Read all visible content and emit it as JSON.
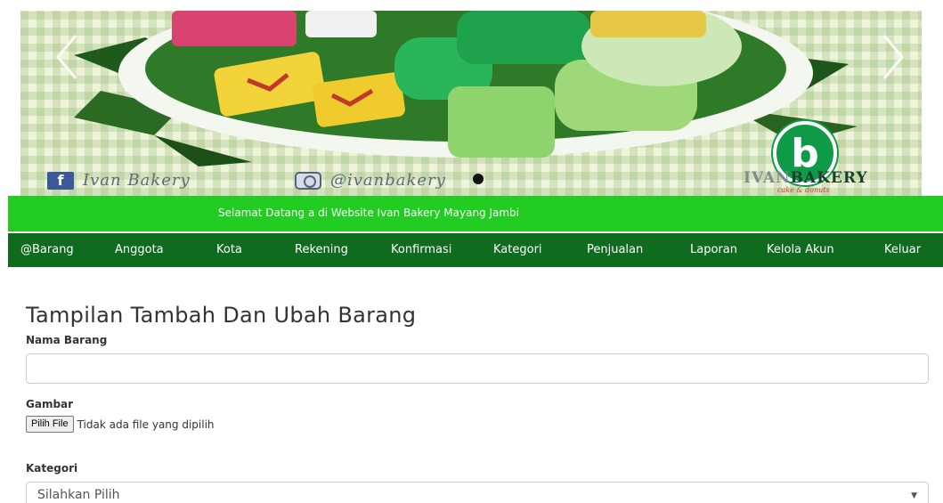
{
  "banner": {
    "facebook_icon": "f",
    "facebook_name": "Ivan Bakery",
    "instagram_handle": "@ivanbakery",
    "logo_mark": "b",
    "logo_brand_ivan": "IVAN",
    "logo_brand_bakery": "BAKERY",
    "logo_tagline": "cake & donuts",
    "prev_icon": "chevron-left-icon",
    "next_icon": "chevron-right-icon",
    "slide_count": 1,
    "active_slide": 1
  },
  "welcome": {
    "text": "Selamat Datang a di Website Ivan Bakery Mayang Jambi"
  },
  "nav": {
    "items": [
      {
        "label": "@Barang"
      },
      {
        "label": "Anggota"
      },
      {
        "label": "Kota"
      },
      {
        "label": "Rekening"
      },
      {
        "label": "Konfirmasi"
      },
      {
        "label": "Kategori"
      },
      {
        "label": "Penjualan"
      },
      {
        "label": "Laporan"
      },
      {
        "label": "Kelola Akun"
      },
      {
        "label": "Keluar"
      }
    ]
  },
  "form": {
    "title": "Tampilan Tambah Dan Ubah Barang",
    "nama_barang_label": "Nama Barang",
    "nama_barang_value": "",
    "gambar_label": "Gambar",
    "file_button": "Pilih File",
    "file_status": "Tidak ada file yang dipilih",
    "kategori_label": "Kategori",
    "kategori_selected": "Silahkan Pilih",
    "kategori_caret": "▼"
  },
  "colors": {
    "welcome_bar": "#22cc22",
    "navbar": "#0f6b1e",
    "logo_green": "#0e9a46"
  }
}
